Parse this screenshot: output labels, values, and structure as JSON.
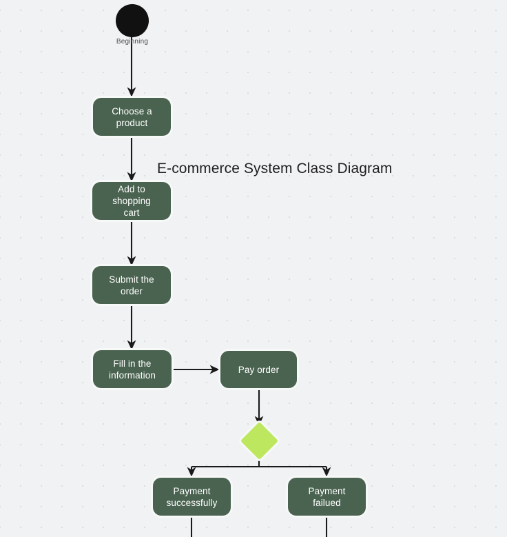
{
  "diagram": {
    "title": "E-commerce System Class Diagram",
    "background_color": "#f1f2f4",
    "dot_color": "#dbdcdf",
    "node_fill": "#4a6350",
    "node_text_color": "#ffffff",
    "decision_fill": "#bde75f",
    "start_fill": "#111111",
    "edge_color": "#1a1a1a",
    "start": {
      "label": "Beginning",
      "shape": "filled-circle"
    },
    "nodes": [
      {
        "id": "choose-a-product",
        "label": "Choose a\nproduct",
        "shape": "rounded-rect"
      },
      {
        "id": "add-to-shopping-cart",
        "label": "Add to shopping\ncart",
        "shape": "rounded-rect"
      },
      {
        "id": "submit-the-order",
        "label": "Submit the\norder",
        "shape": "rounded-rect"
      },
      {
        "id": "fill-in-the-information",
        "label": "Fill in the\ninformation",
        "shape": "rounded-rect"
      },
      {
        "id": "pay-order",
        "label": "Pay order",
        "shape": "rounded-rect"
      },
      {
        "id": "payment-decision",
        "label": "",
        "shape": "diamond"
      },
      {
        "id": "payment-successfully",
        "label": "Payment\nsuccessfully",
        "shape": "rounded-rect"
      },
      {
        "id": "payment-failued",
        "label": "Payment failued",
        "shape": "rounded-rect"
      }
    ],
    "edges": [
      {
        "from": "beginning",
        "to": "choose-a-product"
      },
      {
        "from": "choose-a-product",
        "to": "add-to-shopping-cart"
      },
      {
        "from": "add-to-shopping-cart",
        "to": "submit-the-order"
      },
      {
        "from": "submit-the-order",
        "to": "fill-in-the-information"
      },
      {
        "from": "fill-in-the-information",
        "to": "pay-order"
      },
      {
        "from": "pay-order",
        "to": "payment-decision"
      },
      {
        "from": "payment-decision",
        "to": "payment-successfully"
      },
      {
        "from": "payment-decision",
        "to": "payment-failued"
      },
      {
        "from": "payment-successfully",
        "to": "offscreen-below"
      },
      {
        "from": "payment-failued",
        "to": "offscreen-below"
      }
    ]
  }
}
